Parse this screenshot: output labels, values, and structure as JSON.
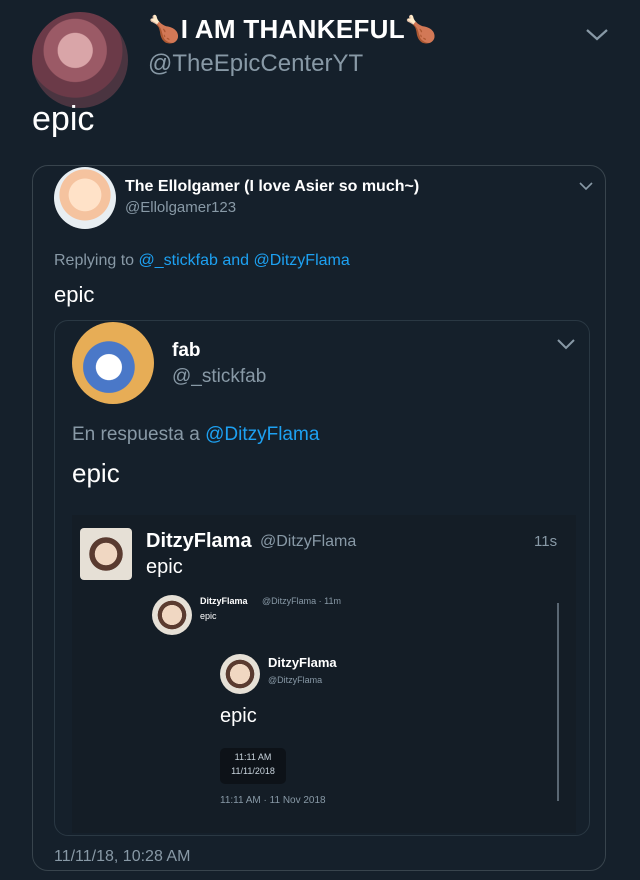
{
  "colors": {
    "background": "#15202b",
    "accent": "#1da1f2",
    "muted": "#8899a6"
  },
  "tweet": {
    "name": "I AM THANKEFUL",
    "name_emoji": "🍗",
    "handle": "@TheEpicCenterYT",
    "text": "epic"
  },
  "quote": {
    "name": "The Ellolgamer (I love Asier so much~)",
    "handle": "@Ellolgamer123",
    "replying_prefix": "Replying to",
    "replying_user1": "@_stickfab",
    "replying_and": "and",
    "replying_user2": "@DitzyFlama",
    "text": "epic",
    "timestamp": "11/11/18, 10:28 AM"
  },
  "quote2": {
    "name": "fab",
    "handle": "@_stickfab",
    "replying_prefix": "En respuesta a",
    "replying_user": "@DitzyFlama",
    "text": "epic"
  },
  "screenshot": {
    "name": "DitzyFlama",
    "handle": "@DitzyFlama",
    "time": "11s",
    "text": "epic",
    "nested1": {
      "name": "DitzyFlama",
      "handle_time": "@DitzyFlama · 11m",
      "text": "epic"
    },
    "nested2": {
      "name": "DitzyFlama",
      "handle": "@DitzyFlama",
      "text": "epic",
      "box_time": "11:11 AM",
      "box_date": "11/11/2018",
      "footer": "11:11 AM · 11 Nov 2018"
    }
  }
}
